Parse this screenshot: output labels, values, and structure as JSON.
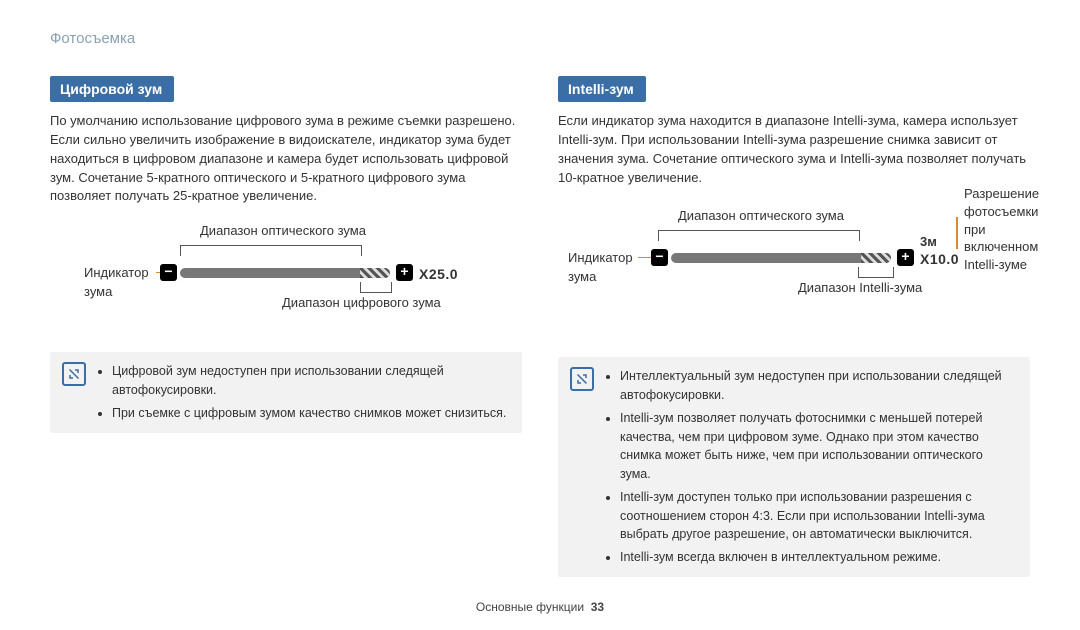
{
  "header": "Фотосъемка",
  "footer": {
    "section": "Основные функции",
    "page": "33"
  },
  "left": {
    "title": "Цифровой зум",
    "para": "По умолчанию использование цифрового зума в режиме съемки разрешено. Если сильно увеличить изображение в видоискателе, индикатор зума будет находиться в цифровом диапазоне и камера будет использовать цифровой зум. Сочетание 5-кратного оптического и 5-кратного цифрового зума позволяет получать 25-кратное увеличение.",
    "diagram": {
      "indicator": "Индикатор зума",
      "optical": "Диапазон оптического зума",
      "digital": "Диапазон цифрового зума",
      "xvalue": "X25.0"
    },
    "notes": [
      "Цифровой зум недоступен при использовании следящей автофокусировки.",
      "При съемке с цифровым зумом качество снимков может снизиться."
    ]
  },
  "right": {
    "title": "Intelli-зум",
    "para": "Если индикатор зума находится в диапазоне Intelli-зума, камера использует Intelli-зум. При использовании Intelli-зума разрешение снимка зависит от значения зума. Сочетание оптического зума и Intelli-зума позволяет получать 10-кратное увеличение.",
    "diagram": {
      "indicator": "Индикатор зума",
      "optical": "Диапазон оптического зума",
      "intelli": "Диапазон Intelli-зума",
      "xvalue": "X10.0",
      "res_label": "Разрешение фотосъемки при включенном Intelli-зуме",
      "res_value": "3м"
    },
    "notes": [
      "Интеллектуальный зум недоступен при использовании следящей автофокусировки.",
      "Intelli-зум позволяет получать фотоснимки с меньшей потерей качества, чем при цифровом зуме. Однако при этом качество снимка может быть ниже, чем при использовании оптического зума.",
      "Intelli-зум доступен только при использовании разрешения с соотношением сторон 4:3. Если при использовании Intelli-зума выбрать другое разрешение, он автоматически выключится.",
      "Intelli-зум всегда включен в интеллектуальном режиме."
    ]
  }
}
